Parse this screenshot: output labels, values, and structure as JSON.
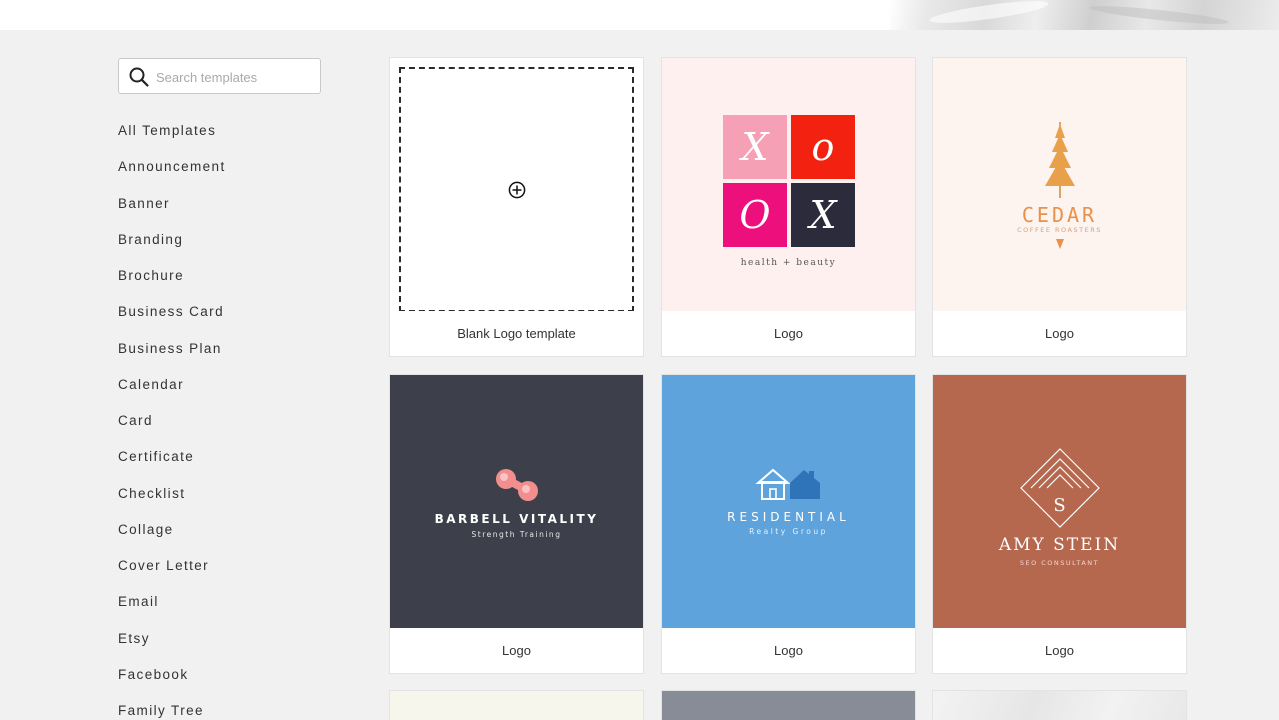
{
  "search": {
    "placeholder": "Search templates"
  },
  "sidebar": {
    "items": [
      "All Templates",
      "Announcement",
      "Banner",
      "Branding",
      "Brochure",
      "Business Card",
      "Business Plan",
      "Calendar",
      "Card",
      "Certificate",
      "Checklist",
      "Collage",
      "Cover Letter",
      "Email",
      "Etsy",
      "Facebook",
      "Family Tree"
    ]
  },
  "cards": [
    {
      "caption": "Blank Logo template"
    },
    {
      "caption": "Logo",
      "letters": [
        "X",
        "o",
        "O",
        "X"
      ],
      "tagline": "health + beauty",
      "colors": [
        "#f6a0b5",
        "#f3210f",
        "#ec0f7c",
        "#2b2b3b"
      ]
    },
    {
      "caption": "Logo",
      "name": "CEDAR",
      "tagline": "COFFEE ROASTERS",
      "accent": "#e9a04a"
    },
    {
      "caption": "Logo",
      "name": "BARBELL VITALITY",
      "tagline": "Strength Training",
      "accent": "#f28e8e"
    },
    {
      "caption": "Logo",
      "name": "RESIDENTIAL",
      "tagline": "Realty Group",
      "accent": "#2f73b8"
    },
    {
      "caption": "Logo",
      "monogram": "S",
      "name": "AMY STEIN",
      "tagline": "SEO CONSULTANT"
    }
  ],
  "icons": {
    "search": "search-icon",
    "add": "plus-circle-icon"
  },
  "colors": {
    "background": "#f1f1f1",
    "card_border": "#e3e3e3"
  }
}
